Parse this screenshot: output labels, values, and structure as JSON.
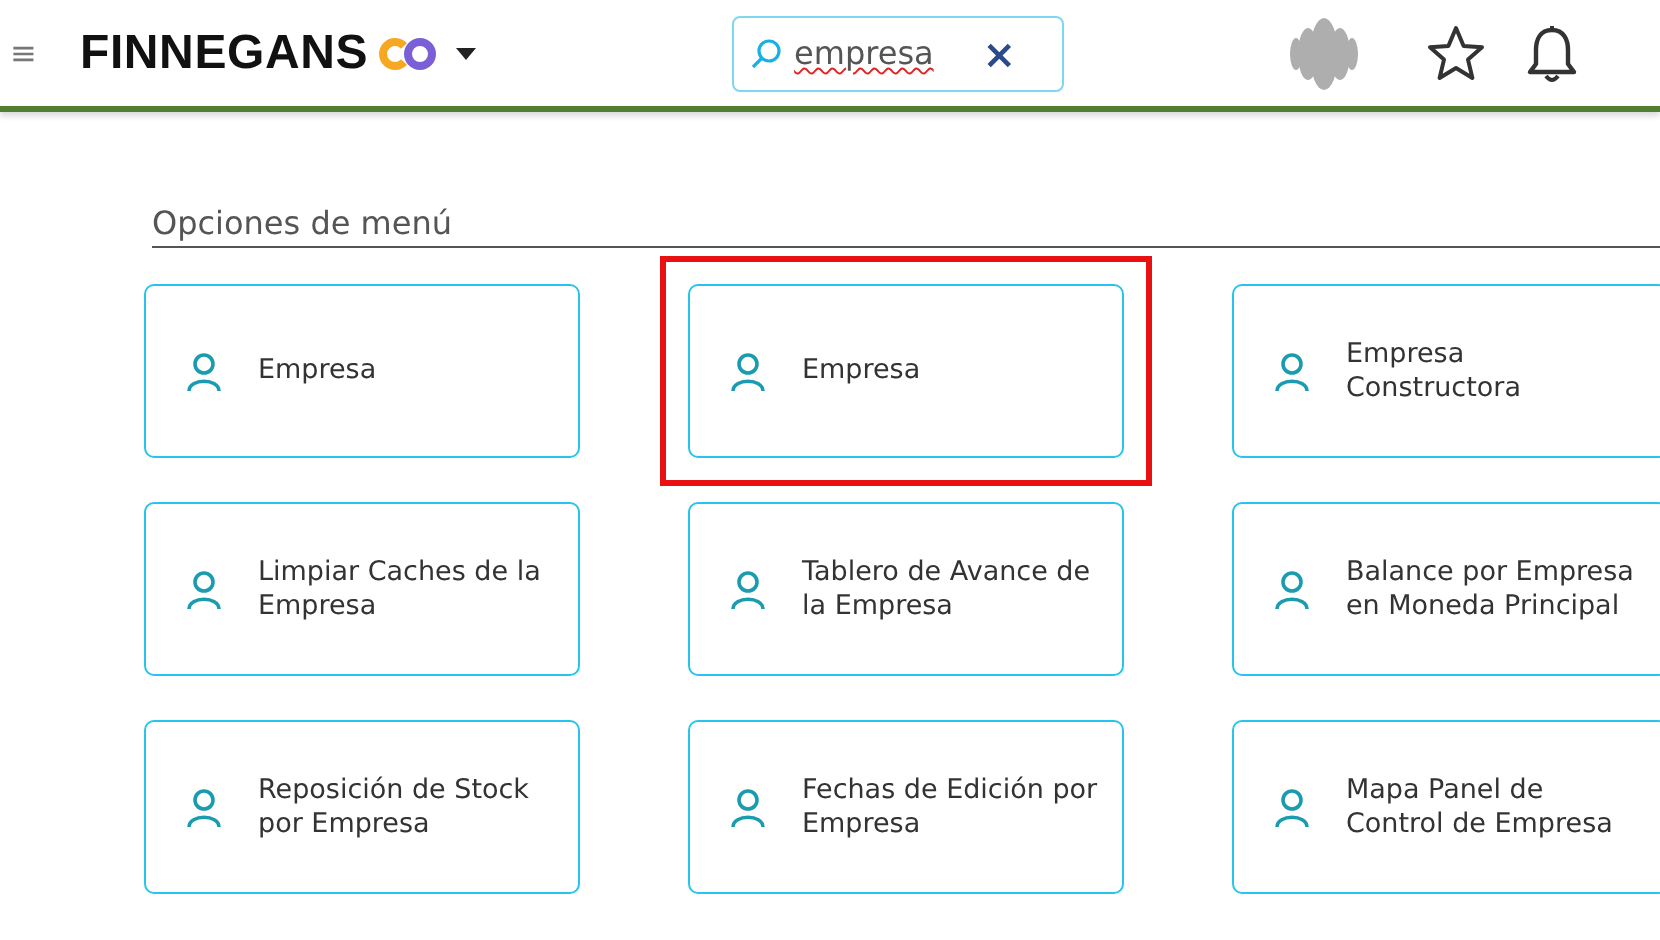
{
  "header": {
    "menu_icon": "≡",
    "brand": "FINNEGANS",
    "search": {
      "value": "empresa",
      "clear": "×"
    }
  },
  "section": {
    "title": "Opciones de menú"
  },
  "items": [
    {
      "label": "Empresa",
      "highlighted": false
    },
    {
      "label": "Empresa",
      "highlighted": true
    },
    {
      "label": "Empresa Constructora",
      "highlighted": false
    },
    {
      "label": "Limpiar Caches de la Empresa",
      "highlighted": false
    },
    {
      "label": "Tablero de Avance de la Empresa",
      "highlighted": false
    },
    {
      "label": "Balance por Empresa en Moneda Principal",
      "highlighted": false
    },
    {
      "label": "Reposición de Stock por Empresa",
      "highlighted": false
    },
    {
      "label": "Fechas de Edición por Empresa",
      "highlighted": false
    },
    {
      "label": "Mapa Panel de Control de Empresa",
      "highlighted": false
    }
  ]
}
